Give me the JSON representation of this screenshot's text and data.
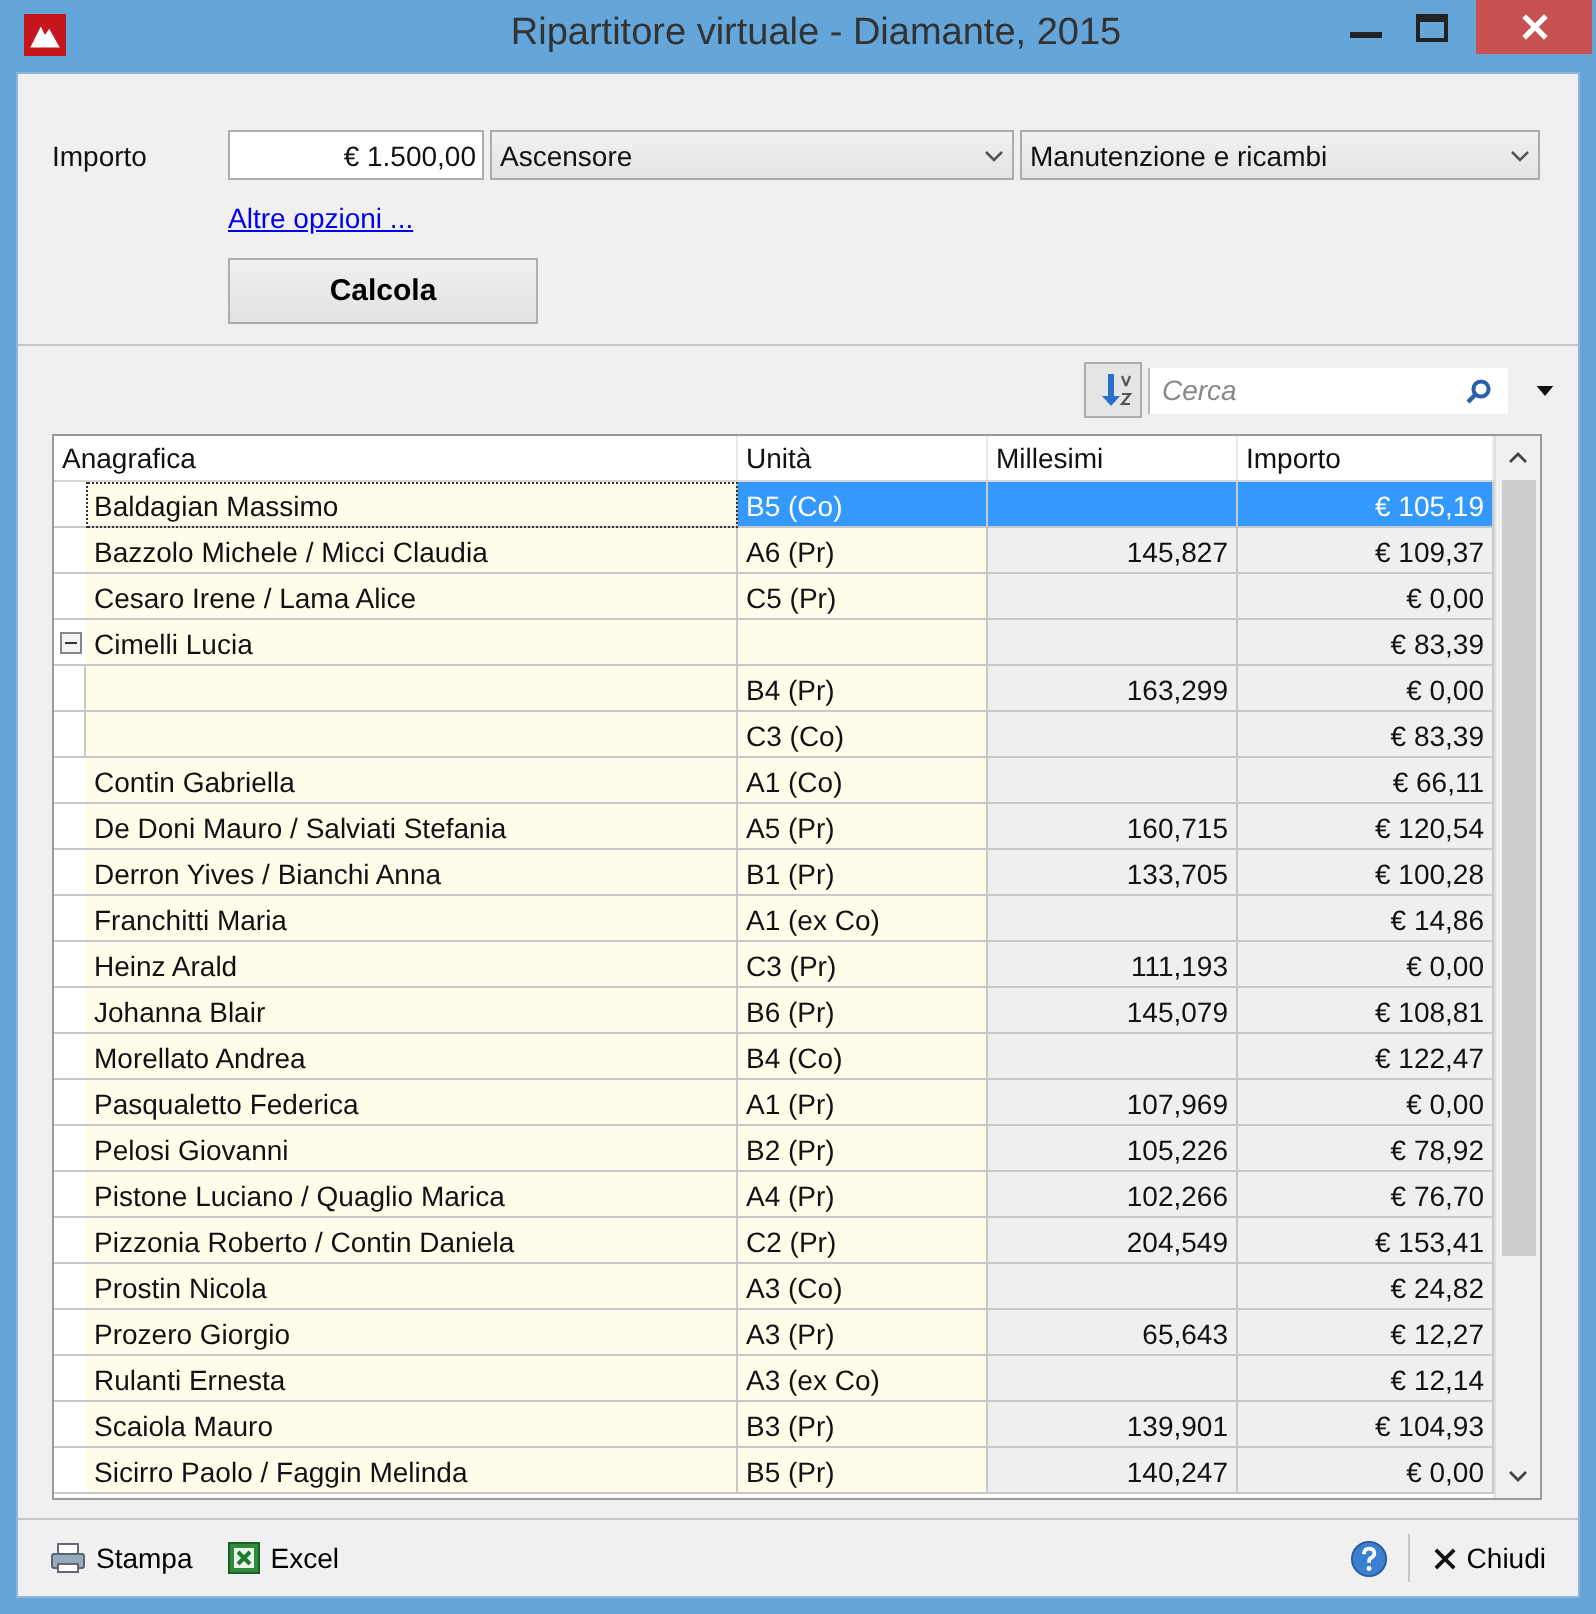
{
  "window": {
    "title": "Ripartitore virtuale - Diamante, 2015"
  },
  "form": {
    "label": "Importo",
    "amount": "€ 1.500,00",
    "category": "Ascensore",
    "subcategory": "Manutenzione e ricambi",
    "link": "Altre opzioni ...",
    "button": "Calcola"
  },
  "search": {
    "placeholder": "Cerca"
  },
  "table": {
    "columns": [
      "Anagrafica",
      "Unità",
      "Millesimi",
      "Importo"
    ],
    "rows": [
      {
        "name": "Baldagian Massimo",
        "unit": "B5 (Co)",
        "importo": "€ 105,19",
        "selected": true
      },
      {
        "name": "Bazzolo Michele / Micci Claudia",
        "unit": "A6 (Pr)",
        "millesimi": "145,827",
        "importo": "€ 109,37",
        "selected": false
      },
      {
        "name": "Cesaro Irene / Lama Alice",
        "unit": "C5 (Pr)",
        "importo": "€ 0,00",
        "selected": false
      },
      {
        "name": "Cimelli Lucia",
        "importo": "€ 83,39",
        "selected": false,
        "expanded": true,
        "children": [
          {
            "unit": "B4 (Pr)",
            "millesimi": "163,299",
            "importo": "€ 0,00",
            "selected": false
          },
          {
            "unit": "C3 (Co)",
            "importo": "€ 83,39",
            "selected": false
          }
        ]
      },
      {
        "name": "Contin Gabriella",
        "unit": "A1 (Co)",
        "importo": "€ 66,11",
        "selected": false
      },
      {
        "name": "De Doni Mauro / Salviati Stefania",
        "unit": "A5 (Pr)",
        "millesimi": "160,715",
        "importo": "€ 120,54",
        "selected": false
      },
      {
        "name": "Derron Yives / Bianchi Anna",
        "unit": "B1 (Pr)",
        "millesimi": "133,705",
        "importo": "€ 100,28",
        "selected": false
      },
      {
        "name": "Franchitti Maria",
        "unit": "A1 (ex Co)",
        "importo": "€ 14,86",
        "selected": false
      },
      {
        "name": "Heinz Arald",
        "unit": "C3 (Pr)",
        "millesimi": "111,193",
        "importo": "€ 0,00",
        "selected": false
      },
      {
        "name": "Johanna Blair",
        "unit": "B6 (Pr)",
        "millesimi": "145,079",
        "importo": "€ 108,81",
        "selected": false
      },
      {
        "name": "Morellato Andrea",
        "unit": "B4 (Co)",
        "importo": "€ 122,47",
        "selected": false
      },
      {
        "name": "Pasqualetto Federica",
        "unit": "A1 (Pr)",
        "millesimi": "107,969",
        "importo": "€ 0,00",
        "selected": false
      },
      {
        "name": "Pelosi Giovanni",
        "unit": "B2 (Pr)",
        "millesimi": "105,226",
        "importo": "€ 78,92",
        "selected": false
      },
      {
        "name": "Pistone Luciano / Quaglio Marica",
        "unit": "A4 (Pr)",
        "millesimi": "102,266",
        "importo": "€ 76,70",
        "selected": false
      },
      {
        "name": "Pizzonia Roberto / Contin Daniela",
        "unit": "C2 (Pr)",
        "millesimi": "204,549",
        "importo": "€ 153,41",
        "selected": false
      },
      {
        "name": "Prostin Nicola",
        "unit": "A3 (Co)",
        "importo": "€ 24,82",
        "selected": false
      },
      {
        "name": "Prozero Giorgio",
        "unit": "A3 (Pr)",
        "millesimi": "65,643",
        "importo": "€ 12,27",
        "selected": false
      },
      {
        "name": "Rulanti Ernesta",
        "unit": "A3 (ex Co)",
        "importo": "€ 12,14",
        "selected": false
      },
      {
        "name": "Scaiola Mauro",
        "unit": "B3 (Pr)",
        "millesimi": "139,901",
        "importo": "€ 104,93",
        "selected": false
      },
      {
        "name": "Sicirro Paolo / Faggin Melinda",
        "unit": "B5 (Pr)",
        "millesimi": "140,247",
        "importo": "€ 0,00",
        "selected": false
      }
    ]
  },
  "footer": {
    "print": "Stampa",
    "excel": "Excel",
    "close": "Chiudi"
  }
}
